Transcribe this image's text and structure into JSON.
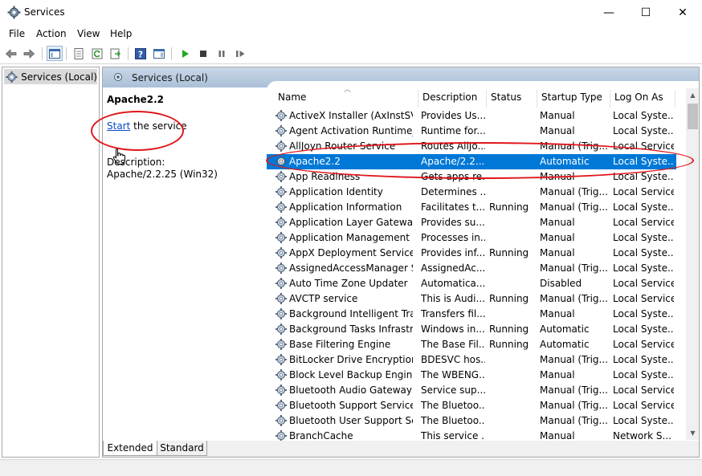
{
  "window": {
    "title": "Services",
    "minimize_glyph": "—",
    "maximize_glyph": "☐",
    "close_glyph": "✕"
  },
  "menu": [
    "File",
    "Action",
    "View",
    "Help"
  ],
  "tree": {
    "root_label": "Services (Local)"
  },
  "content": {
    "header_label": "Services (Local)",
    "selected_service": "Apache2.2",
    "start_link": "Start",
    "start_suffix": " the service",
    "description_label": "Description:",
    "description_value": "Apache/2.2.25 (Win32)"
  },
  "columns": [
    "Name",
    "Description",
    "Status",
    "Startup Type",
    "Log On As"
  ],
  "services": [
    {
      "name": "ActiveX Installer (AxInstSV)",
      "description": "Provides Us...",
      "status": "",
      "startup": "Manual",
      "logon": "Local Syste..."
    },
    {
      "name": "Agent Activation Runtime_...",
      "description": "Runtime for...",
      "status": "",
      "startup": "Manual",
      "logon": "Local Syste..."
    },
    {
      "name": "AllJoyn Router Service",
      "description": "Routes AllJo...",
      "status": "",
      "startup": "Manual (Trig...",
      "logon": "Local Service"
    },
    {
      "name": "Apache2.2",
      "description": "Apache/2.2....",
      "status": "",
      "startup": "Automatic",
      "logon": "Local Syste...",
      "selected": true
    },
    {
      "name": "App Readiness",
      "description": "Gets apps re...",
      "status": "",
      "startup": "Manual",
      "logon": "Local Syste..."
    },
    {
      "name": "Application Identity",
      "description": "Determines ...",
      "status": "",
      "startup": "Manual (Trig...",
      "logon": "Local Service"
    },
    {
      "name": "Application Information",
      "description": "Facilitates t...",
      "status": "Running",
      "startup": "Manual (Trig...",
      "logon": "Local Syste..."
    },
    {
      "name": "Application Layer Gateway ...",
      "description": "Provides su...",
      "status": "",
      "startup": "Manual",
      "logon": "Local Service"
    },
    {
      "name": "Application Management",
      "description": "Processes in...",
      "status": "",
      "startup": "Manual",
      "logon": "Local Syste..."
    },
    {
      "name": "AppX Deployment Service (...",
      "description": "Provides inf...",
      "status": "Running",
      "startup": "Manual",
      "logon": "Local Syste..."
    },
    {
      "name": "AssignedAccessManager Se...",
      "description": "AssignedAc...",
      "status": "",
      "startup": "Manual (Trig...",
      "logon": "Local Syste..."
    },
    {
      "name": "Auto Time Zone Updater",
      "description": "Automatica...",
      "status": "",
      "startup": "Disabled",
      "logon": "Local Service"
    },
    {
      "name": "AVCTP service",
      "description": "This is Audi...",
      "status": "Running",
      "startup": "Manual (Trig...",
      "logon": "Local Service"
    },
    {
      "name": "Background Intelligent Tran...",
      "description": "Transfers fil...",
      "status": "",
      "startup": "Manual",
      "logon": "Local Syste..."
    },
    {
      "name": "Background Tasks Infrastruc...",
      "description": "Windows in...",
      "status": "Running",
      "startup": "Automatic",
      "logon": "Local Syste..."
    },
    {
      "name": "Base Filtering Engine",
      "description": "The Base Fil...",
      "status": "Running",
      "startup": "Automatic",
      "logon": "Local Service"
    },
    {
      "name": "BitLocker Drive Encryption ...",
      "description": "BDESVC hos...",
      "status": "",
      "startup": "Manual (Trig...",
      "logon": "Local Syste..."
    },
    {
      "name": "Block Level Backup Engine ...",
      "description": "The WBENG...",
      "status": "",
      "startup": "Manual",
      "logon": "Local Syste..."
    },
    {
      "name": "Bluetooth Audio Gateway S...",
      "description": "Service sup...",
      "status": "",
      "startup": "Manual (Trig...",
      "logon": "Local Service"
    },
    {
      "name": "Bluetooth Support Service",
      "description": "The Bluetoo...",
      "status": "",
      "startup": "Manual (Trig...",
      "logon": "Local Service"
    },
    {
      "name": "Bluetooth User Support Ser...",
      "description": "The Bluetoo...",
      "status": "",
      "startup": "Manual (Trig...",
      "logon": "Local Syste..."
    },
    {
      "name": "BranchCache",
      "description": "This service ...",
      "status": "",
      "startup": "Manual",
      "logon": "Network S..."
    }
  ],
  "tabs": {
    "extended": "Extended",
    "standard": "Standard"
  },
  "icons": {
    "app": "gear-icon",
    "back": "arrow-left-icon",
    "forward": "arrow-right-icon",
    "console_tree": "console-tree-icon",
    "properties": "properties-icon",
    "refresh": "refresh-icon",
    "export": "export-list-icon",
    "help": "help-icon",
    "action_pane": "action-pane-icon",
    "start": "play-icon",
    "stop": "stop-icon",
    "pause": "pause-icon",
    "restart": "restart-icon",
    "service": "service-gear-icon",
    "cursor": "hand-cursor-icon"
  },
  "colors": {
    "selection": "#0078d7",
    "link": "#0b4cc9",
    "annotation": "#e0161b",
    "header_gradient_top": "#c9d7e7",
    "header_gradient_bottom": "#aac0d8"
  }
}
